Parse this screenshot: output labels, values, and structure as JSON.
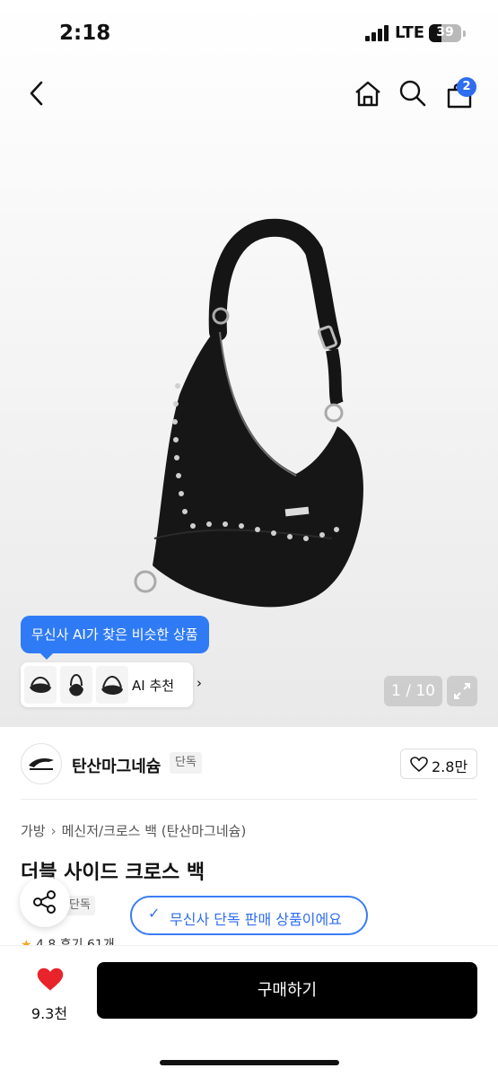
{
  "status": {
    "time": "2:18",
    "network": "LTE",
    "battery": "39"
  },
  "nav": {
    "cart_count": "2"
  },
  "gallery": {
    "ai_tooltip": "무신사 AI가 찾은 비슷한 상품",
    "ai_recommend_label": "AI 추천",
    "pager": "1 / 10"
  },
  "brand": {
    "name": "탄산마그네슘",
    "tag": "단독",
    "likes": "2.8만"
  },
  "product": {
    "breadcrumb": [
      "가방",
      "메신저/크로스 백 (탄산마그네슘)"
    ],
    "title": "더블 사이드 크로스 백",
    "exclusive_tag": "단독",
    "exclusive_banner": "무신사 단독 판매 상품이에요",
    "rating": "4.8",
    "reviews": "후기 61개"
  },
  "bottom": {
    "heart_count": "9.3천",
    "buy_label": "구매하기"
  },
  "colors": {
    "accent": "#2f7bf5",
    "heart": "#e8232a",
    "buy": "#000000"
  }
}
